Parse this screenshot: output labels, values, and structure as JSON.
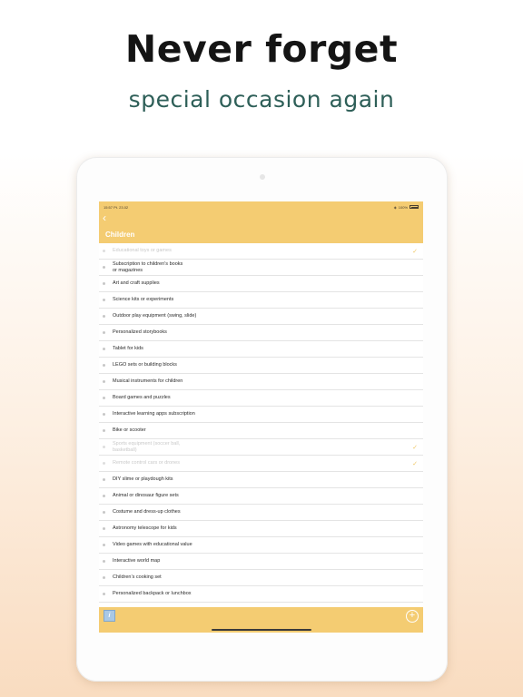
{
  "promo": {
    "headline": "Never forget",
    "subheadline": "special occasion again"
  },
  "status_bar": {
    "time": "15:57",
    "date": "Pt. 23.02",
    "battery": "100%"
  },
  "nav": {
    "back_icon": "chevron-left-icon",
    "title": "Children"
  },
  "items": [
    {
      "label": "Educational toys or games",
      "done": true
    },
    {
      "label": "Subscription to children’s books\nor magazines",
      "done": false
    },
    {
      "label": "Art and craft supplies",
      "done": false
    },
    {
      "label": "Science kits or experiments",
      "done": false
    },
    {
      "label": "Outdoor play equipment (swing, slide)",
      "done": false
    },
    {
      "label": "Personalized storybooks",
      "done": false
    },
    {
      "label": "Tablet for kids",
      "done": false
    },
    {
      "label": "LEGO sets or building blocks",
      "done": false
    },
    {
      "label": "Musical instruments for children",
      "done": false
    },
    {
      "label": "Board games and puzzles",
      "done": false
    },
    {
      "label": "Interactive learning apps subscription",
      "done": false
    },
    {
      "label": "Bike or scooter",
      "done": false
    },
    {
      "label": "Sports equipment (soccer ball,\nbasketball)",
      "done": true
    },
    {
      "label": "Remote control cars or drones",
      "done": true
    },
    {
      "label": "DIY slime or playdough kits",
      "done": false
    },
    {
      "label": "Animal or dinosaur figure sets",
      "done": false
    },
    {
      "label": "Costume and dress-up clothes",
      "done": false
    },
    {
      "label": "Astronomy telescope for kids",
      "done": false
    },
    {
      "label": "Video games with educational value",
      "done": false
    },
    {
      "label": "Interactive world map",
      "done": false
    },
    {
      "label": "Children’s cooking set",
      "done": false
    },
    {
      "label": "Personalized backpack or lunchbox",
      "done": false
    }
  ],
  "toolbar": {
    "info_icon": "info-icon",
    "info_glyph": "i",
    "add_icon": "plus-circle-icon",
    "add_glyph": "+"
  },
  "colors": {
    "accent": "#f4cc72",
    "check": "#f0c766",
    "subheadline": "#2e5f58"
  }
}
